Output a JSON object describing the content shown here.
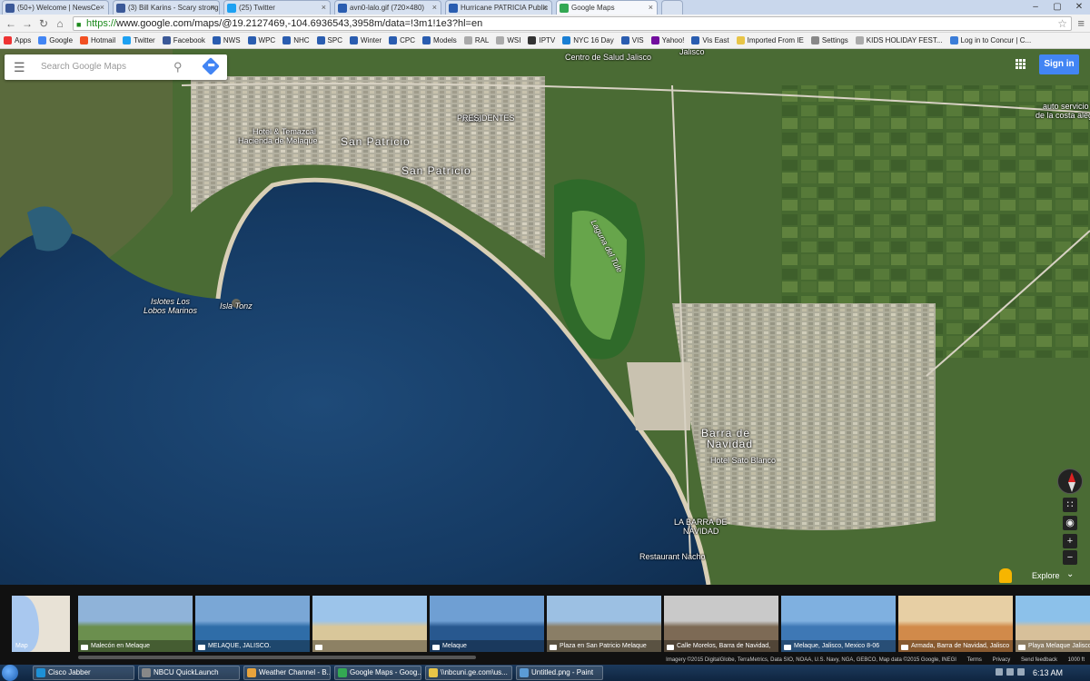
{
  "browser": {
    "tabs": [
      {
        "label": "(50+) Welcome | NewsCe",
        "color": "#3b5998"
      },
      {
        "label": "(3) Bill Karins - Scary strong",
        "color": "#3b5998"
      },
      {
        "label": "(25) Twitter",
        "color": "#1da1f2"
      },
      {
        "label": "avn0-lalo.gif (720×480)",
        "color": "#2a5db0"
      },
      {
        "label": "Hurricane PATRICIA Public",
        "color": "#2a5db0"
      },
      {
        "label": "Google Maps",
        "color": "#34a853"
      }
    ],
    "url_scheme": "https://",
    "url_rest": "www.google.com/maps/@19.2127469,-104.6936543,3958m/data=!3m1!1e3?hl=en",
    "bookmarks": [
      {
        "label": "Apps",
        "color": "#e33"
      },
      {
        "label": "Google",
        "color": "#4285f4"
      },
      {
        "label": "Hotmail",
        "color": "#f25022"
      },
      {
        "label": "Twitter",
        "color": "#1da1f2"
      },
      {
        "label": "Facebook",
        "color": "#3b5998"
      },
      {
        "label": "NWS",
        "color": "#2a5db0"
      },
      {
        "label": "WPC",
        "color": "#2a5db0"
      },
      {
        "label": "NHC",
        "color": "#2a5db0"
      },
      {
        "label": "SPC",
        "color": "#2a5db0"
      },
      {
        "label": "Winter",
        "color": "#2a5db0"
      },
      {
        "label": "CPC",
        "color": "#2a5db0"
      },
      {
        "label": "Models",
        "color": "#2a5db0"
      },
      {
        "label": "RAL",
        "color": "#aaaaaa"
      },
      {
        "label": "WSI",
        "color": "#aaaaaa"
      },
      {
        "label": "IPTV",
        "color": "#333333"
      },
      {
        "label": "NYC 16 Day",
        "color": "#1a7fd4"
      },
      {
        "label": "VIS",
        "color": "#2a5db0"
      },
      {
        "label": "Yahoo!",
        "color": "#720e9e"
      },
      {
        "label": "Vis East",
        "color": "#2a5db0"
      },
      {
        "label": "Imported From IE",
        "color": "#e8c547"
      },
      {
        "label": "Settings",
        "color": "#888888"
      },
      {
        "label": "KIDS HOLIDAY FEST...",
        "color": "#aaaaaa"
      },
      {
        "label": "Log in to Concur | C...",
        "color": "#3b7dd8"
      }
    ]
  },
  "maps": {
    "search_placeholder": "Search Google Maps",
    "signin_label": "Sign in",
    "explore_label": "Explore",
    "labels": {
      "centro_salud": "Centro de Salud Jalisco",
      "jalisco": "Jalisco",
      "presidentes": "PRESIDENTES",
      "san_patricio_1": "San Patricio",
      "san_patricio_2": "San Patricio",
      "hotel_temazcal": "Hotel & Temazcal",
      "hacienda": "Hacienda de Melaque",
      "islotes_1": "Islotes Los",
      "islotes_2": "Lobos Marinos",
      "isla_tonz": "Isla Tonz",
      "laguna": "Laguna del Tule",
      "barra_1": "Barra de",
      "barra_2": "Navidad",
      "hotel_barra": "Hotel Sato Blanco",
      "la_barra_1": "LA BARRA DE",
      "la_barra_2": "NAVIDAD",
      "restaurant": "Restaurant Nacho",
      "auto_servicio_1": "auto servicio su",
      "auto_servicio_2": "de la costa alegre",
      "kulko": "Kulko"
    },
    "road_shields": [
      "200",
      "200",
      "80",
      "200"
    ]
  },
  "filmstrip": {
    "minimap_label": "Map",
    "photos": [
      {
        "caption": "Malecón en Melaque",
        "sky": "#8fb3d9",
        "ground": "#6b8f4e"
      },
      {
        "caption": "MELAQUE, JALISCO.",
        "sky": "#7aa7d6",
        "ground": "#2f6da8"
      },
      {
        "caption": "",
        "sky": "#9cc4ea",
        "ground": "#d9c79a"
      },
      {
        "caption": "Melaque",
        "sky": "#6f9fd3",
        "ground": "#28588f"
      },
      {
        "caption": "Plaza en San Patricio Melaque",
        "sky": "#9cc0e3",
        "ground": "#8a7e66"
      },
      {
        "caption": "Calle Morelos, Barra de Navidad,",
        "sky": "#c9c9c9",
        "ground": "#7d6a55"
      },
      {
        "caption": "Melaque, Jalisco, Mexico 8-06",
        "sky": "#7fb0e0",
        "ground": "#3e78b5"
      },
      {
        "caption": "Armada, Barra de Navidad, Jalisco",
        "sky": "#e7cfa4",
        "ground": "#d18a4a"
      },
      {
        "caption": "Playa Melaque Jalisco",
        "sky": "#8cc1ea",
        "ground": "#d7c09a"
      }
    ]
  },
  "attribution": {
    "imagery": "Imagery ©2015 DigitalGlobe, TerraMetrics, Data SIO, NOAA, U.S. Navy, NGA, GEBCO, Map data ©2015 Google, INEGI",
    "terms": "Terms",
    "privacy": "Privacy",
    "feedback": "Send feedback",
    "scale": "1000 ft"
  },
  "taskbar": {
    "items": [
      {
        "label": "Cisco Jabber",
        "color": "#1e90d6"
      },
      {
        "label": "NBCU QuickLaunch",
        "color": "#888888"
      },
      {
        "label": "Weather Channel - B...",
        "color": "#e8a33c"
      },
      {
        "label": "Google Maps - Goog...",
        "color": "#34a853"
      },
      {
        "label": "\\\\nbcuni.ge.com\\us...",
        "color": "#e8c547"
      },
      {
        "label": "Untitled.png - Paint",
        "color": "#5b9bd5"
      }
    ],
    "clock": "6:13 AM"
  }
}
